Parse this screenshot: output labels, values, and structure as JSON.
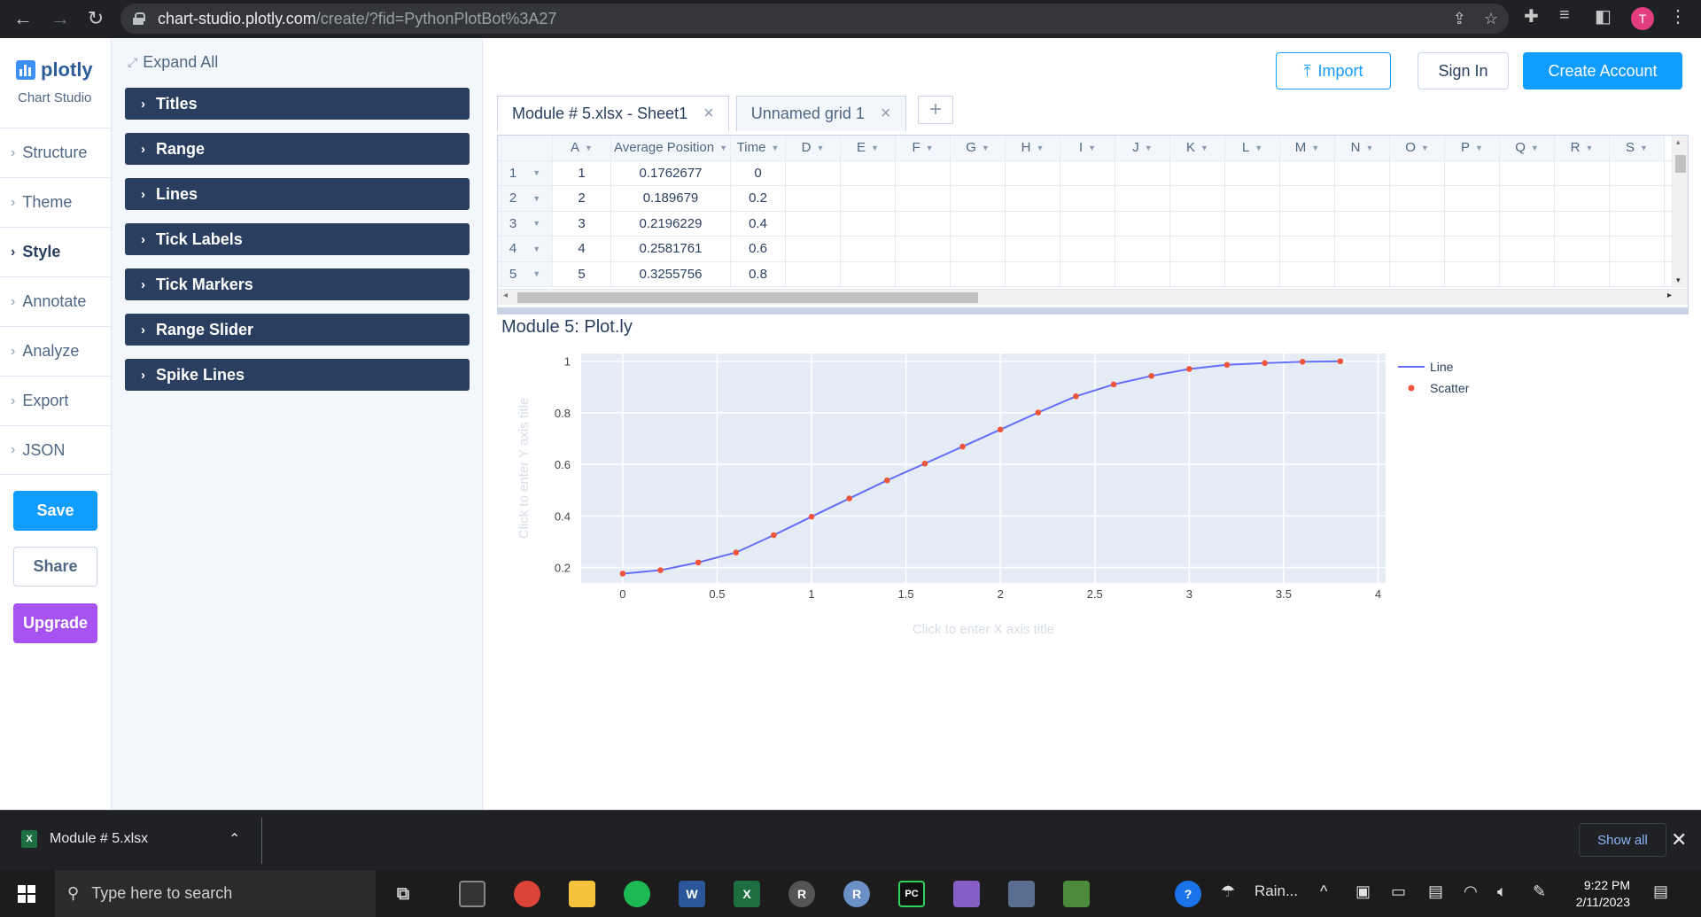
{
  "browser": {
    "url_host": "chart-studio.plotly.com",
    "url_path": "/create/?fid=PythonPlotBot%3A27",
    "avatar_letter": "T"
  },
  "brand": {
    "name": "plotly",
    "sub": "Chart Studio"
  },
  "nav": {
    "items": [
      "Structure",
      "Theme",
      "Style",
      "Annotate",
      "Analyze",
      "Export",
      "JSON"
    ],
    "active": "Style",
    "save": "Save",
    "share": "Share",
    "upgrade": "Upgrade"
  },
  "panel": {
    "expand_all": "Expand All",
    "sections": [
      "Titles",
      "Range",
      "Lines",
      "Tick Labels",
      "Tick Markers",
      "Range Slider",
      "Spike Lines"
    ]
  },
  "header": {
    "import": "Import",
    "sign_in": "Sign In",
    "create_account": "Create Account"
  },
  "tabs": [
    {
      "label": "Module # 5.xlsx - Sheet1",
      "active": true
    },
    {
      "label": "Unnamed grid 1",
      "active": false
    }
  ],
  "grid": {
    "columns": [
      "A",
      "Average Position",
      "Time",
      "D",
      "E",
      "F",
      "G",
      "H",
      "I",
      "J",
      "K",
      "L",
      "M",
      "N",
      "O",
      "P",
      "Q",
      "R",
      "S"
    ],
    "rows": [
      [
        "1",
        "0.1762677",
        "0"
      ],
      [
        "2",
        "0.189679",
        "0.2"
      ],
      [
        "3",
        "0.2196229",
        "0.4"
      ],
      [
        "4",
        "0.2581761",
        "0.6"
      ],
      [
        "5",
        "0.3255756",
        "0.8"
      ]
    ],
    "row_numbers": [
      "1",
      "2",
      "3",
      "4",
      "5"
    ]
  },
  "chart_data": {
    "type": "line",
    "title": "Module 5: Plot.ly",
    "xlabel_placeholder": "Click to enter X axis title",
    "ylabel_placeholder": "Click to enter Y axis title",
    "xlim": [
      -0.22,
      4.04
    ],
    "ylim": [
      0.14,
      1.03
    ],
    "xticks": [
      0,
      0.5,
      1,
      1.5,
      2,
      2.5,
      3,
      3.5,
      4
    ],
    "xtick_labels": [
      "0",
      "0.5",
      "1",
      "1.5",
      "2",
      "2.5",
      "3",
      "3.5",
      "4"
    ],
    "yticks": [
      0.2,
      0.4,
      0.6,
      0.8,
      1
    ],
    "ytick_labels": [
      "0.2",
      "0.4",
      "0.6",
      "0.8",
      "1"
    ],
    "grid": true,
    "legend_position": "top-right",
    "x": [
      0,
      0.2,
      0.4,
      0.6,
      0.8,
      1.0,
      1.2,
      1.4,
      1.6,
      1.8,
      2.0,
      2.2,
      2.4,
      2.6,
      2.8,
      3.0,
      3.2,
      3.4,
      3.6,
      3.8
    ],
    "y": [
      0.1762677,
      0.189679,
      0.2196229,
      0.2581761,
      0.3255756,
      0.397,
      0.468,
      0.538,
      0.603,
      0.669,
      0.735,
      0.801,
      0.864,
      0.91,
      0.943,
      0.97,
      0.986,
      0.993,
      0.998,
      1.0
    ],
    "series": [
      {
        "name": "Line",
        "color": "#636efa"
      },
      {
        "name": "Scatter",
        "color": "#ef553b"
      }
    ],
    "plot_bg": "#e5ecf6"
  },
  "downloads": {
    "file": "Module # 5.xlsx",
    "show_all": "Show all"
  },
  "taskbar": {
    "search_placeholder": "Type here to search",
    "weather": "Rain...",
    "time": "9:22 PM",
    "date": "2/11/2023"
  }
}
